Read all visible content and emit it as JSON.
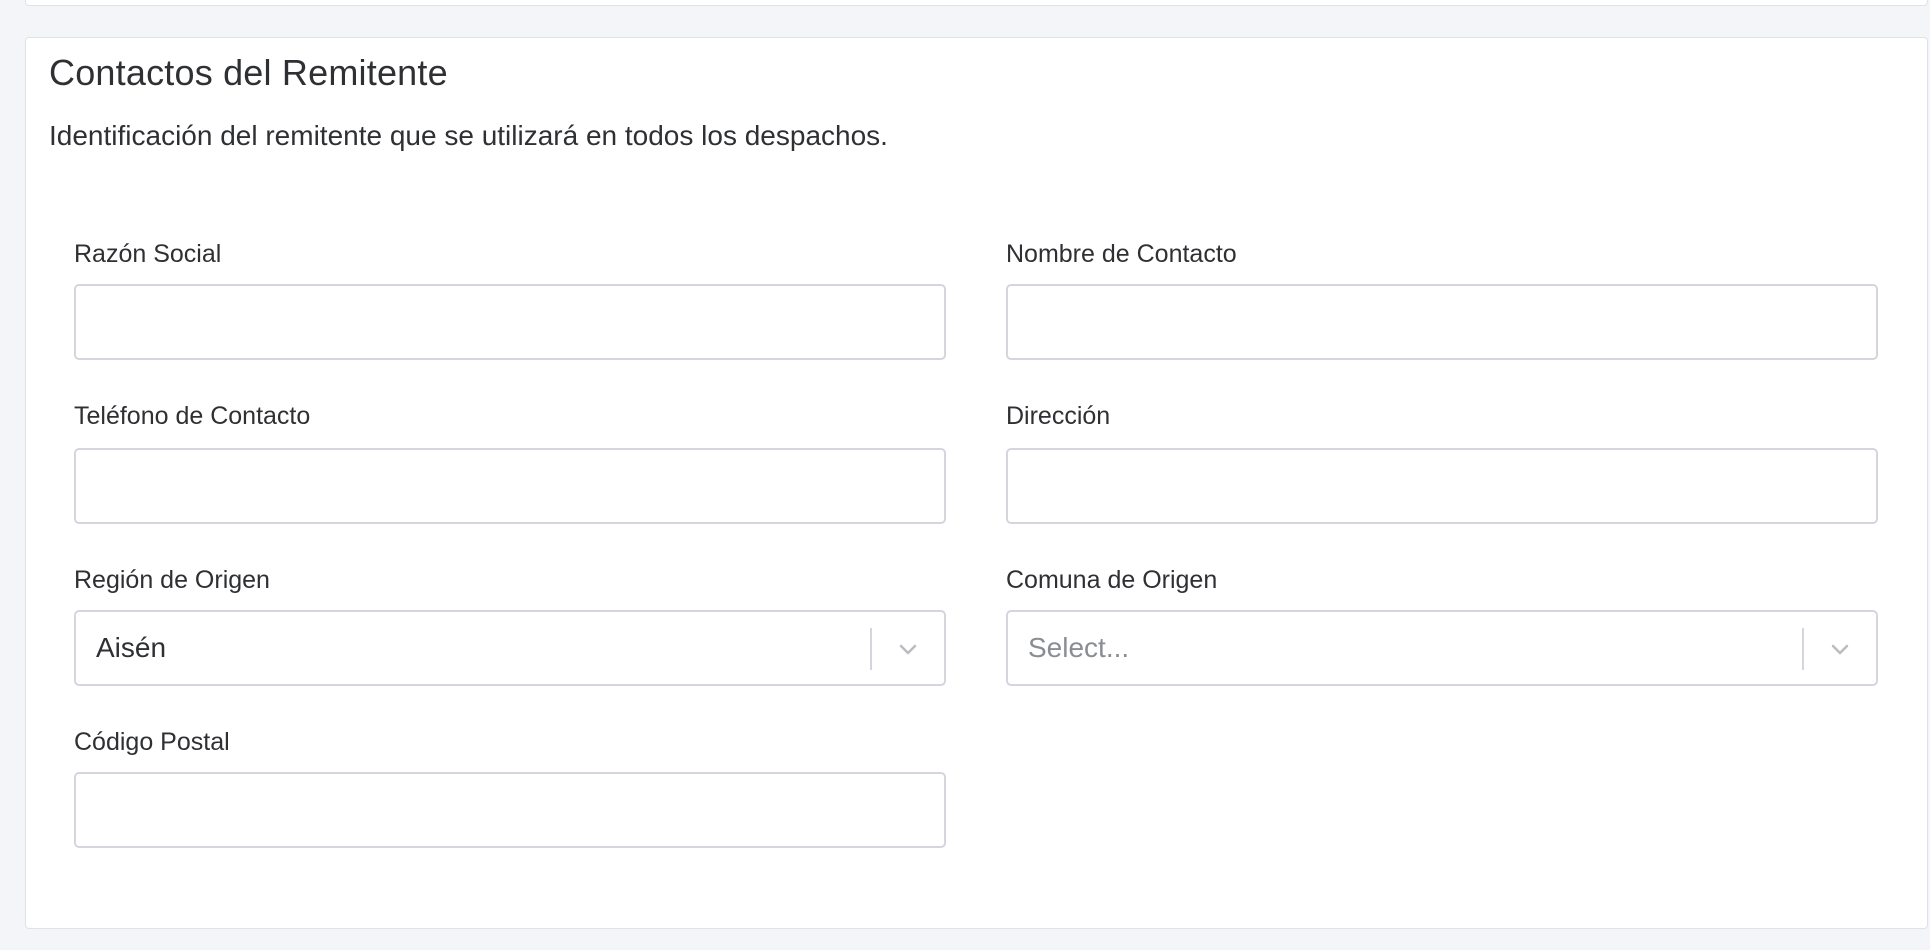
{
  "section": {
    "title": "Contactos del Remitente",
    "description": "Identificación del remitente que se utilizará en todos los despachos."
  },
  "fields": {
    "razon_social": {
      "label": "Razón Social",
      "value": ""
    },
    "nombre_contacto": {
      "label": "Nombre de Contacto",
      "value": ""
    },
    "telefono_contacto": {
      "label": "Teléfono de Contacto",
      "value": ""
    },
    "direccion": {
      "label": "Dirección",
      "value": ""
    },
    "region_origen": {
      "label": "Región de Origen",
      "value": "Aisén"
    },
    "comuna_origen": {
      "label": "Comuna de Origen",
      "placeholder": "Select..."
    },
    "codigo_postal": {
      "label": "Código Postal",
      "value": ""
    }
  },
  "icons": {
    "select_chevron": "chevron-down-icon"
  },
  "colors": {
    "background": "#f4f5f8",
    "card": "#ffffff",
    "border": "#d3d6dc",
    "text": "#2f3033",
    "placeholder": "#8a8d93"
  }
}
